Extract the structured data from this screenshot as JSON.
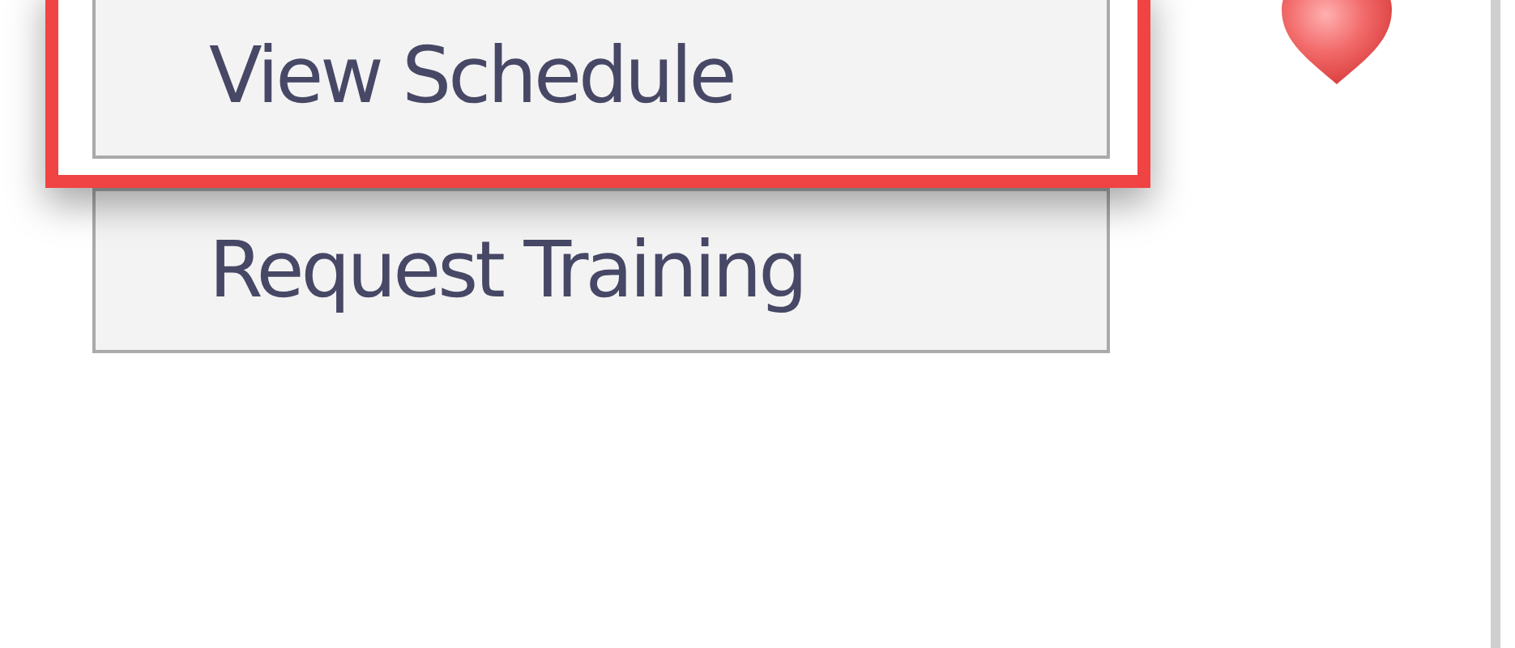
{
  "menu": {
    "items": [
      {
        "label": "View Schedule",
        "highlighted": true
      },
      {
        "label": "Request Training",
        "highlighted": false
      }
    ]
  }
}
